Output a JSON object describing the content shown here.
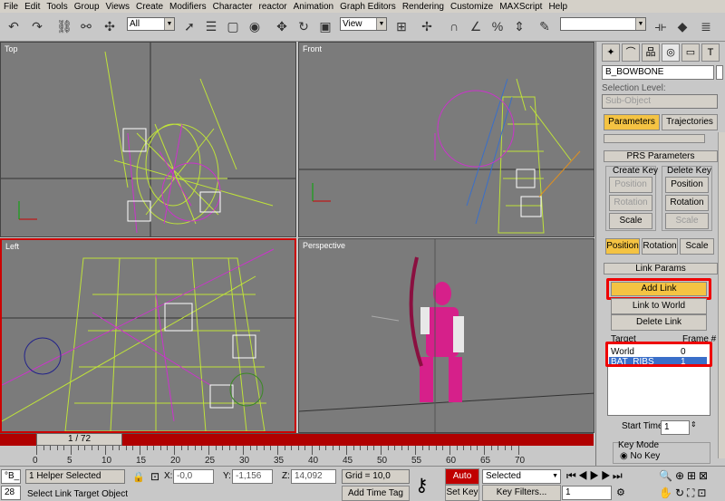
{
  "menu": [
    "File",
    "Edit",
    "Tools",
    "Group",
    "Views",
    "Create",
    "Modifiers",
    "Character",
    "reactor",
    "Animation",
    "Graph Editors",
    "Rendering",
    "Customize",
    "MAXScript",
    "Help"
  ],
  "toolbar": {
    "selection_filter": "All",
    "ref_coord": "View",
    "named_selection": ""
  },
  "viewports": [
    {
      "label": "Top"
    },
    {
      "label": "Front"
    },
    {
      "label": "Left"
    },
    {
      "label": "Perspective"
    }
  ],
  "panel": {
    "object_name": "B_BOWBONE",
    "selection_level_label": "Selection Level:",
    "sub_object": "Sub-Object",
    "parameters_tab": "Parameters",
    "trajectories_tab": "Trajectories",
    "prs_header": "PRS Parameters",
    "create_key_label": "Create Key",
    "delete_key_label": "Delete Key",
    "create_position": "Position",
    "create_rotation": "Rotation",
    "create_scale": "Scale",
    "delete_position": "Position",
    "delete_rotation": "Rotation",
    "delete_scale": "Scale",
    "mode_position": "Position",
    "mode_rotation": "Rotation",
    "mode_scale": "Scale",
    "link_header": "Link Params",
    "add_link": "Add Link",
    "link_to_world": "Link to World",
    "delete_link": "Delete Link",
    "target_col": "Target",
    "frame_col": "Frame #",
    "links": [
      {
        "target": "World",
        "frame": "0"
      },
      {
        "target": "BAT_RIBS",
        "frame": "1"
      }
    ],
    "start_time_label": "Start Time:",
    "start_time": "1",
    "key_mode_label": "Key Mode",
    "no_key": "No Key"
  },
  "timeline": {
    "slider": "1 / 72",
    "ticks": [
      "0",
      "5",
      "10",
      "15",
      "20",
      "25",
      "30",
      "35",
      "40",
      "45",
      "50",
      "55",
      "60",
      "65",
      "70"
    ]
  },
  "status": {
    "selected": "1 Helper Selected",
    "prompt": "Select Link Target Object",
    "x_label": "X:",
    "x": "-0,0",
    "y_label": "Y:",
    "y": "-1,156",
    "z_label": "Z:",
    "z": "14,092",
    "grid": "Grid = 10,0",
    "add_time_tag": "Add Time Tag",
    "auto_key": "Auto Key",
    "set_key": "Set Key",
    "key_filters": "Key Filters...",
    "selected_dd": "Selected",
    "frame": "1",
    "left_field": "28",
    "left_top": "°B_"
  },
  "colors": {
    "active_border": "#cc0000",
    "highlight": "#ee0000",
    "button_on": "#f4c343",
    "selection": "#3a6fc9",
    "timebar": "#b00000"
  }
}
